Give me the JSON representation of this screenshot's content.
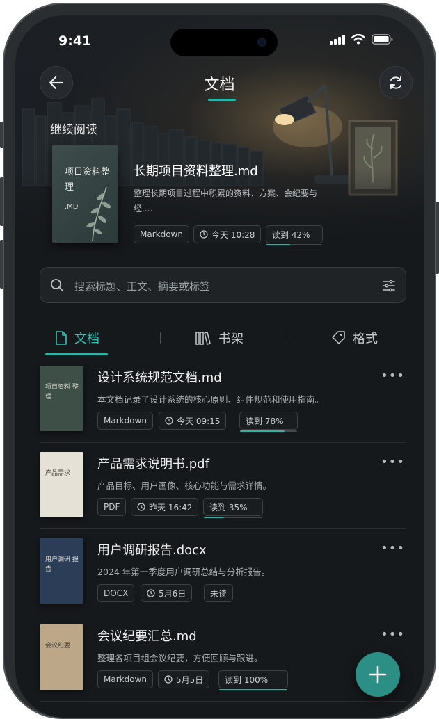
{
  "status": {
    "time": "9:41"
  },
  "nav": {
    "title": "文档"
  },
  "continue_reading": {
    "label": "继续阅读",
    "cover_title": "项目资料整理",
    "cover_ext": ".MD",
    "title": "长期项目资料整理.md",
    "desc": "整理长期项目过程中积累的资料、方案、会纪要与经....",
    "format": "Markdown",
    "time": "今天 10:28",
    "progress_label": "读到 42%",
    "progress": 0.42
  },
  "search": {
    "placeholder": "搜索标题、正文、摘要或标签"
  },
  "tabs": [
    {
      "label": "文档",
      "icon": "document-icon",
      "active": true
    },
    {
      "label": "书架",
      "icon": "bookshelf-icon",
      "active": false
    },
    {
      "label": "格式",
      "icon": "tag-icon",
      "active": false
    }
  ],
  "documents": [
    {
      "title": "设计系统规范文档.md",
      "desc": "本文档记录了设计系统的核心原则、组件规范和使用指南。",
      "format": "Markdown",
      "time": "今天 09:15",
      "status": "读到 78%",
      "progress": 0.78,
      "cover_text": "项目资料 整理",
      "cover_color": "#3e4f47"
    },
    {
      "title": "产品需求说明书.pdf",
      "desc": "产品目标、用户画像、核心功能与需求详情。",
      "format": "PDF",
      "time": "昨天 16:42",
      "status": "读到 35%",
      "progress": 0.35,
      "cover_text": "产品需求",
      "cover_color": "#e6e1d6"
    },
    {
      "title": "用户调研报告.docx",
      "desc": "2024 年第一季度用户调研总结与分析报告。",
      "format": "DOCX",
      "time": "5月6日",
      "status": "未读",
      "progress": null,
      "cover_text": "用户调研 报告",
      "cover_color": "#2c3d57"
    },
    {
      "title": "会议纪要汇总.md",
      "desc": "整理各项目组会议纪要，方便回顾与跟进。",
      "format": "Markdown",
      "time": "5月5日",
      "status": "读到 100%",
      "progress": 1.0,
      "cover_text": "会议纪要",
      "cover_color": "#bca888"
    }
  ],
  "colors": {
    "accent": "#2fb3a6",
    "background": "#16191c"
  }
}
